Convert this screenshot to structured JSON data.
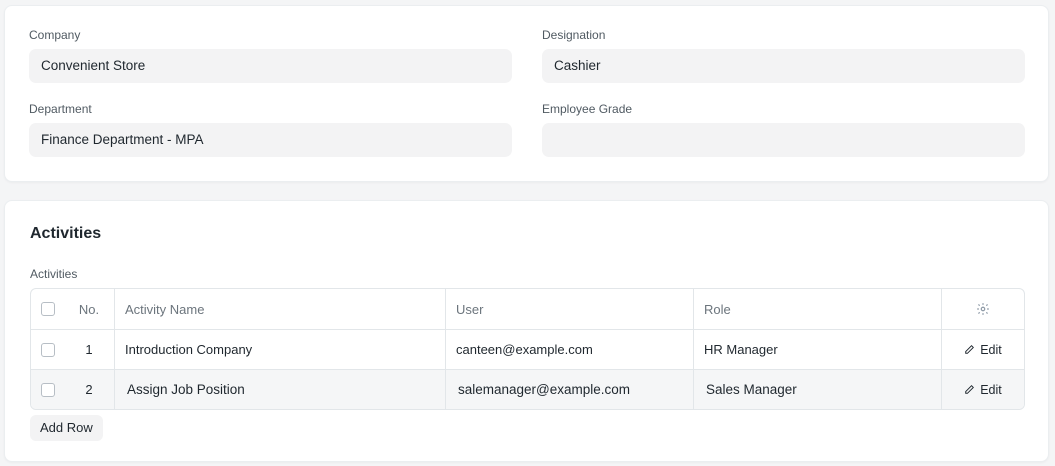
{
  "details": {
    "company": {
      "label": "Company",
      "value": "Convenient Store"
    },
    "designation": {
      "label": "Designation",
      "value": "Cashier"
    },
    "department": {
      "label": "Department",
      "value": "Finance Department - MPA"
    },
    "employee_grade": {
      "label": "Employee Grade",
      "value": ""
    }
  },
  "activities": {
    "section_title": "Activities",
    "grid_label": "Activities",
    "columns": {
      "no": "No.",
      "activity_name": "Activity Name",
      "user": "User",
      "role": "Role"
    },
    "rows": [
      {
        "no": "1",
        "activity_name": "Introduction Company",
        "user": "canteen@example.com",
        "role": "HR Manager",
        "edit": "Edit"
      },
      {
        "no": "2",
        "activity_name": "Assign Job Position",
        "user": "salemanager@example.com",
        "role": "Sales Manager",
        "edit": "Edit"
      }
    ],
    "add_row_label": "Add Row"
  },
  "icons": {
    "settings": "gear-icon",
    "edit": "pencil-icon"
  }
}
